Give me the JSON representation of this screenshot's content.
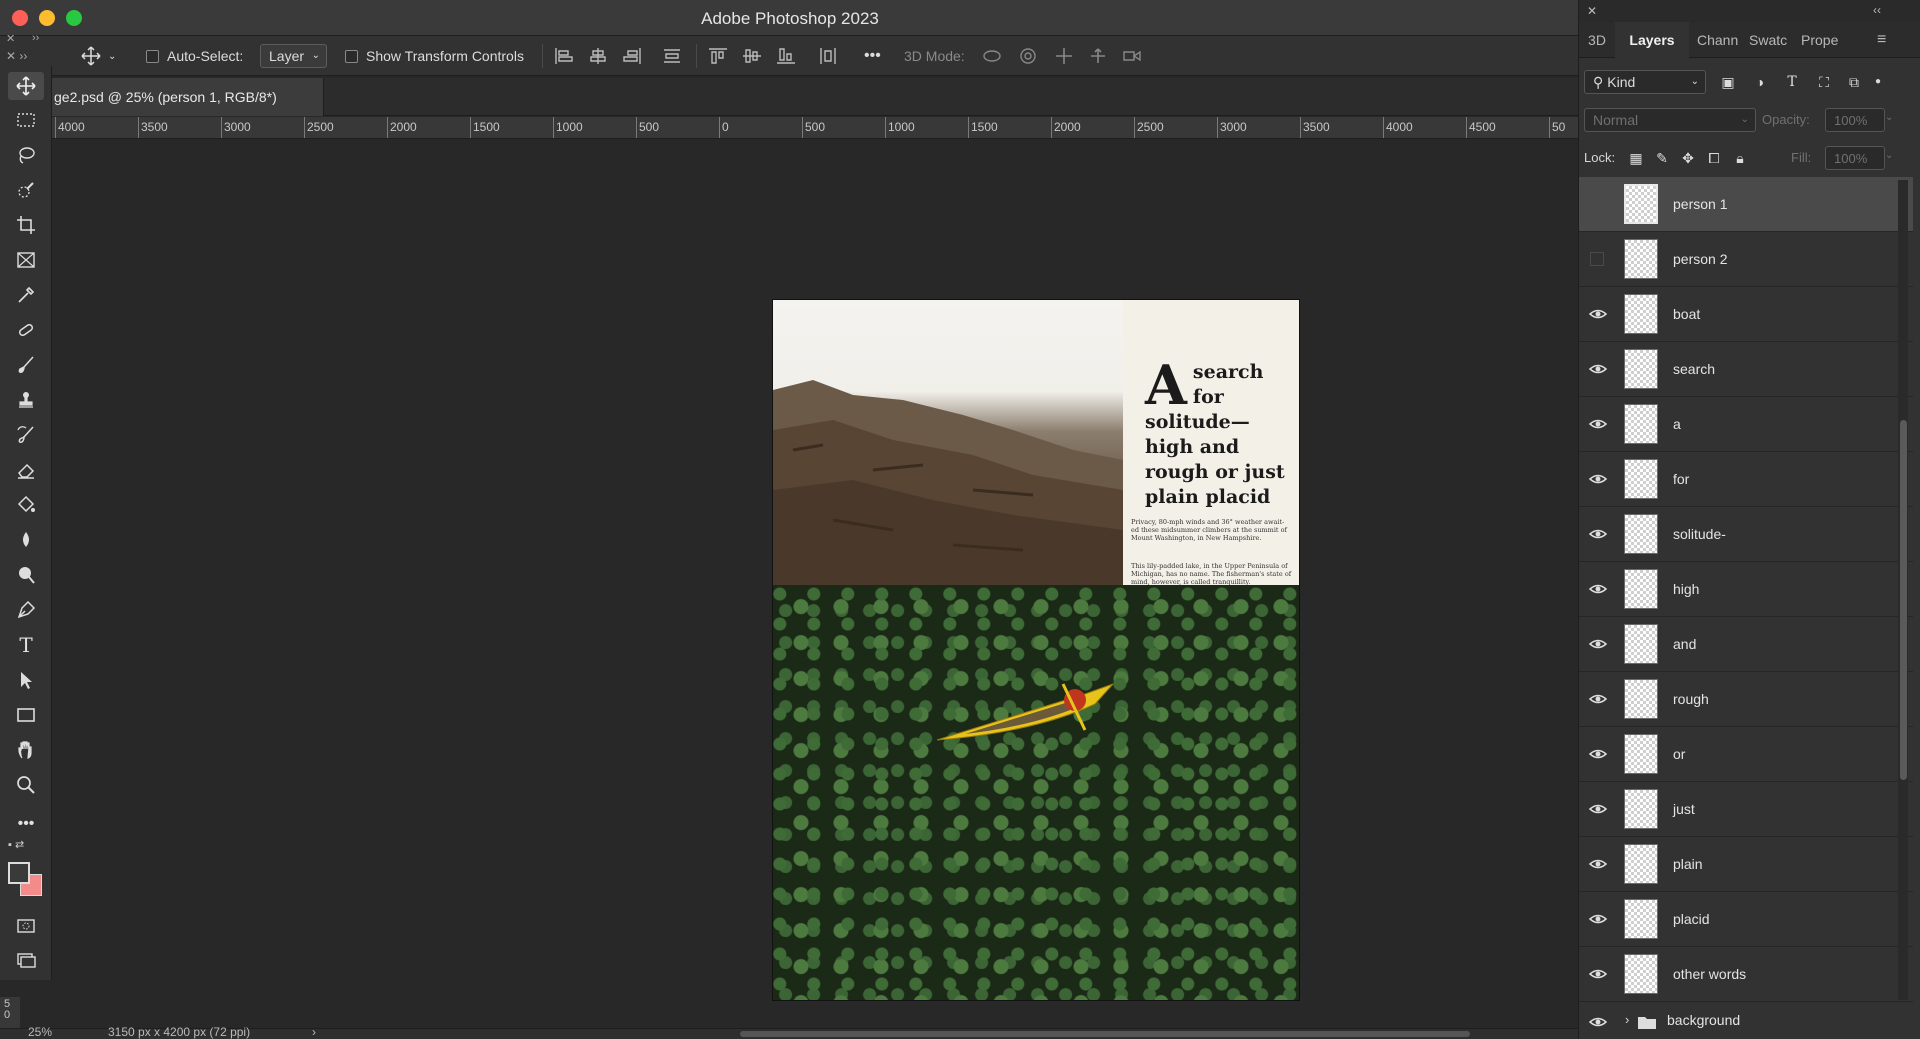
{
  "app": {
    "title": "Adobe Photoshop 2023"
  },
  "options_bar": {
    "auto_select_label": "Auto-Select:",
    "auto_select_value": "Layer",
    "show_transform_label": "Show Transform Controls",
    "more_label": "•••",
    "mode_3d_label": "3D Mode:"
  },
  "document": {
    "tab_title": "ge2.psd @ 25% (person 1, RGB/8*)",
    "headline_big": "A",
    "headline_rest": "search for solitude—high and rough or just plain placid",
    "caption1": "Privacy, 80-mph winds and 36° weather await- ed these midsummer climbers at the summit of Mount Washington, in New Hampshire.",
    "caption2": "This lily-padded lake, in the Upper Peninsula of Michigan, has no name. The fisherman's state of mind, however, is called tranquillity."
  },
  "ruler": {
    "ticks": [
      "4000",
      "3500",
      "3000",
      "2500",
      "2000",
      "1500",
      "1000",
      "500",
      "0",
      "500",
      "1000",
      "1500",
      "2000",
      "2500",
      "3000",
      "3500",
      "4000",
      "4500",
      "50"
    ]
  },
  "vertical_ruler_text": "5\n0",
  "status": {
    "zoom": "25%",
    "doc_size": "3150 px x 4200 px (72 ppi)",
    "arrow": "›"
  },
  "panel": {
    "tabs": [
      "3D",
      "Layers",
      "Chann",
      "Swatc",
      "Prope"
    ],
    "filter_kind": "Kind",
    "blend_mode": "Normal",
    "opacity_label": "Opacity:",
    "opacity_value": "100%",
    "lock_label": "Lock:",
    "fill_label": "Fill:",
    "fill_value": "100%"
  },
  "layers": [
    {
      "name": "person 1",
      "visible": false,
      "selected": true
    },
    {
      "name": "person 2",
      "visible": false,
      "selected": false
    },
    {
      "name": "boat",
      "visible": true,
      "selected": false
    },
    {
      "name": "search",
      "visible": true,
      "selected": false
    },
    {
      "name": "a",
      "visible": true,
      "selected": false
    },
    {
      "name": "for",
      "visible": true,
      "selected": false
    },
    {
      "name": "solitude-",
      "visible": true,
      "selected": false
    },
    {
      "name": "high",
      "visible": true,
      "selected": false
    },
    {
      "name": "and",
      "visible": true,
      "selected": false
    },
    {
      "name": "rough",
      "visible": true,
      "selected": false
    },
    {
      "name": "or",
      "visible": true,
      "selected": false
    },
    {
      "name": "just",
      "visible": true,
      "selected": false
    },
    {
      "name": "plain",
      "visible": true,
      "selected": false
    },
    {
      "name": "placid",
      "visible": true,
      "selected": false
    },
    {
      "name": "other words",
      "visible": true,
      "selected": false
    }
  ],
  "background_group": {
    "name": "background"
  },
  "icons": {
    "move": "move-icon",
    "marquee": "marquee-icon",
    "lasso": "lasso-icon",
    "quick_select": "quick-select-icon",
    "crop": "crop-icon",
    "frame": "frame-icon",
    "eyedropper": "eyedropper-icon",
    "healing": "healing-brush-icon",
    "brush": "brush-icon",
    "stamp": "clone-stamp-icon",
    "history_brush": "history-brush-icon",
    "eraser": "eraser-icon",
    "bucket": "paint-bucket-icon",
    "blur": "blur-icon",
    "dodge": "dodge-icon",
    "pen": "pen-icon",
    "type": "type-icon",
    "path_select": "path-selection-icon",
    "rectangle": "rectangle-icon",
    "hand": "hand-icon",
    "zoom": "zoom-icon",
    "more": "more-tools-icon"
  },
  "colors": {
    "foreground": "#3a3a3a",
    "background": "#f48a8a",
    "accent": "#4a4a4a"
  }
}
